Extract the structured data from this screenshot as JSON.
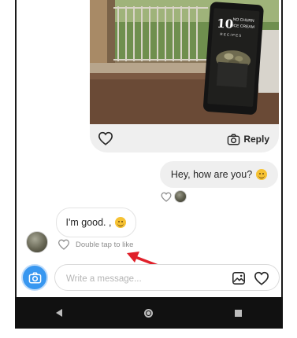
{
  "photo_post": {
    "book_title_number": "10",
    "book_title_line1": "NO CHURN",
    "book_title_line2": "ICE CREAM",
    "book_subtitle": "RECIPES",
    "like_icon": "heart-outline-icon",
    "reply_icon": "camera-outline-icon",
    "reply_label": "Reply"
  },
  "outgoing_message": {
    "text": "Hey, how are you?",
    "emoji": "hugging-face-emoji"
  },
  "incoming_message": {
    "text": "I'm good. ,",
    "emoji": "smiling-face-emoji",
    "like_hint": "Double tap to like"
  },
  "composer": {
    "placeholder": "Write a message...",
    "camera_icon": "camera-icon",
    "gallery_icon": "image-icon",
    "heart_icon": "heart-outline-icon"
  },
  "colors": {
    "accent": "#3897f0",
    "annotation_arrow": "#e0202a",
    "bubble_bg": "#efefef"
  },
  "navbar": {
    "icons": [
      "back-triangle-icon",
      "home-circle-icon",
      "recents-square-icon"
    ]
  }
}
